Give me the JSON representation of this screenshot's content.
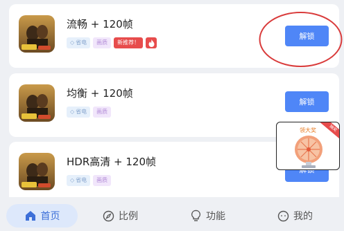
{
  "colors": {
    "accent": "#4f86f7",
    "tag_red": "#e74c4c",
    "annotation_circle": "#d93b3b",
    "nav_active": "#3d6fd8"
  },
  "cards": [
    {
      "title": "流畅 + 120帧",
      "tags": [
        "省电",
        "画质",
        "新推荐！",
        "fire-icon"
      ],
      "button": "解锁"
    },
    {
      "title": "均衡 + 120帧",
      "tags": [
        "省电",
        "画质"
      ],
      "button": "解锁"
    },
    {
      "title": "HDR高清 + 120帧",
      "tags": [
        "省电",
        "画质"
      ],
      "button": "解锁"
    }
  ],
  "ad": {
    "title": "领大奖",
    "ribbon": "抽奖"
  },
  "nav": {
    "home": "首页",
    "ratio": "比例",
    "func": "功能",
    "mine": "我的"
  }
}
